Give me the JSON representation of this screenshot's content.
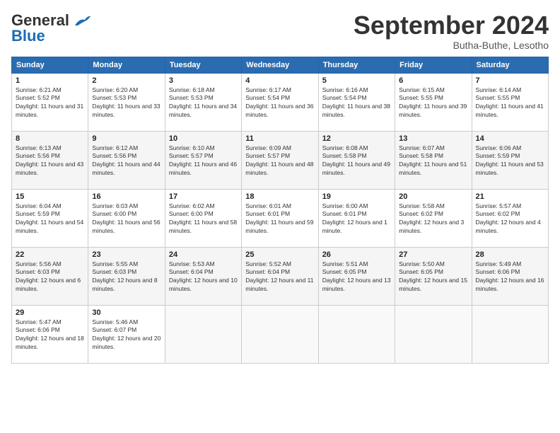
{
  "logo": {
    "line1": "General",
    "line2": "Blue"
  },
  "header": {
    "month": "September 2024",
    "location": "Butha-Buthe, Lesotho"
  },
  "columns": [
    "Sunday",
    "Monday",
    "Tuesday",
    "Wednesday",
    "Thursday",
    "Friday",
    "Saturday"
  ],
  "weeks": [
    [
      {
        "day": "1",
        "sunrise": "6:21 AM",
        "sunset": "5:52 PM",
        "daylight": "11 hours and 31 minutes."
      },
      {
        "day": "2",
        "sunrise": "6:20 AM",
        "sunset": "5:53 PM",
        "daylight": "11 hours and 33 minutes."
      },
      {
        "day": "3",
        "sunrise": "6:18 AM",
        "sunset": "5:53 PM",
        "daylight": "11 hours and 34 minutes."
      },
      {
        "day": "4",
        "sunrise": "6:17 AM",
        "sunset": "5:54 PM",
        "daylight": "11 hours and 36 minutes."
      },
      {
        "day": "5",
        "sunrise": "6:16 AM",
        "sunset": "5:54 PM",
        "daylight": "11 hours and 38 minutes."
      },
      {
        "day": "6",
        "sunrise": "6:15 AM",
        "sunset": "5:55 PM",
        "daylight": "11 hours and 39 minutes."
      },
      {
        "day": "7",
        "sunrise": "6:14 AM",
        "sunset": "5:55 PM",
        "daylight": "11 hours and 41 minutes."
      }
    ],
    [
      {
        "day": "8",
        "sunrise": "6:13 AM",
        "sunset": "5:56 PM",
        "daylight": "11 hours and 43 minutes."
      },
      {
        "day": "9",
        "sunrise": "6:12 AM",
        "sunset": "5:56 PM",
        "daylight": "11 hours and 44 minutes."
      },
      {
        "day": "10",
        "sunrise": "6:10 AM",
        "sunset": "5:57 PM",
        "daylight": "11 hours and 46 minutes."
      },
      {
        "day": "11",
        "sunrise": "6:09 AM",
        "sunset": "5:57 PM",
        "daylight": "11 hours and 48 minutes."
      },
      {
        "day": "12",
        "sunrise": "6:08 AM",
        "sunset": "5:58 PM",
        "daylight": "11 hours and 49 minutes."
      },
      {
        "day": "13",
        "sunrise": "6:07 AM",
        "sunset": "5:58 PM",
        "daylight": "11 hours and 51 minutes."
      },
      {
        "day": "14",
        "sunrise": "6:06 AM",
        "sunset": "5:59 PM",
        "daylight": "11 hours and 53 minutes."
      }
    ],
    [
      {
        "day": "15",
        "sunrise": "6:04 AM",
        "sunset": "5:59 PM",
        "daylight": "11 hours and 54 minutes."
      },
      {
        "day": "16",
        "sunrise": "6:03 AM",
        "sunset": "6:00 PM",
        "daylight": "11 hours and 56 minutes."
      },
      {
        "day": "17",
        "sunrise": "6:02 AM",
        "sunset": "6:00 PM",
        "daylight": "11 hours and 58 minutes."
      },
      {
        "day": "18",
        "sunrise": "6:01 AM",
        "sunset": "6:01 PM",
        "daylight": "11 hours and 59 minutes."
      },
      {
        "day": "19",
        "sunrise": "6:00 AM",
        "sunset": "6:01 PM",
        "daylight": "12 hours and 1 minute."
      },
      {
        "day": "20",
        "sunrise": "5:58 AM",
        "sunset": "6:02 PM",
        "daylight": "12 hours and 3 minutes."
      },
      {
        "day": "21",
        "sunrise": "5:57 AM",
        "sunset": "6:02 PM",
        "daylight": "12 hours and 4 minutes."
      }
    ],
    [
      {
        "day": "22",
        "sunrise": "5:56 AM",
        "sunset": "6:03 PM",
        "daylight": "12 hours and 6 minutes."
      },
      {
        "day": "23",
        "sunrise": "5:55 AM",
        "sunset": "6:03 PM",
        "daylight": "12 hours and 8 minutes."
      },
      {
        "day": "24",
        "sunrise": "5:53 AM",
        "sunset": "6:04 PM",
        "daylight": "12 hours and 10 minutes."
      },
      {
        "day": "25",
        "sunrise": "5:52 AM",
        "sunset": "6:04 PM",
        "daylight": "12 hours and 11 minutes."
      },
      {
        "day": "26",
        "sunrise": "5:51 AM",
        "sunset": "6:05 PM",
        "daylight": "12 hours and 13 minutes."
      },
      {
        "day": "27",
        "sunrise": "5:50 AM",
        "sunset": "6:05 PM",
        "daylight": "12 hours and 15 minutes."
      },
      {
        "day": "28",
        "sunrise": "5:49 AM",
        "sunset": "6:06 PM",
        "daylight": "12 hours and 16 minutes."
      }
    ],
    [
      {
        "day": "29",
        "sunrise": "5:47 AM",
        "sunset": "6:06 PM",
        "daylight": "12 hours and 18 minutes."
      },
      {
        "day": "30",
        "sunrise": "5:46 AM",
        "sunset": "6:07 PM",
        "daylight": "12 hours and 20 minutes."
      },
      null,
      null,
      null,
      null,
      null
    ]
  ]
}
